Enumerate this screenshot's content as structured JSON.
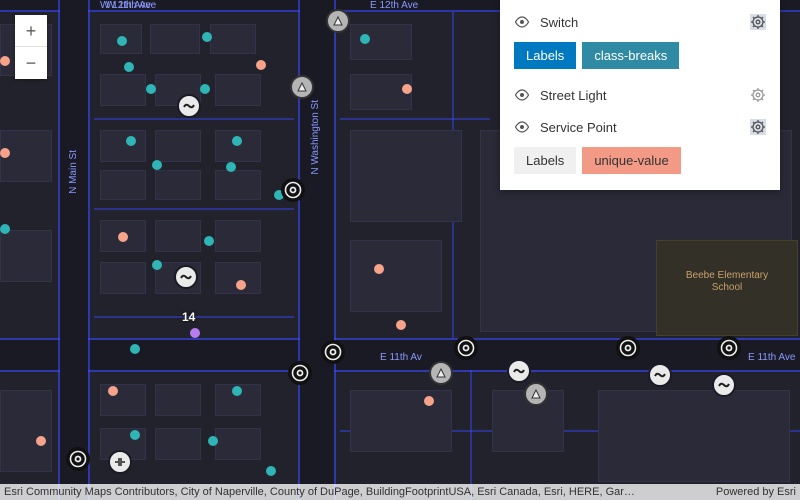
{
  "roads": {
    "w12th": "W 12th Ave",
    "e12th": "E 12th Ave",
    "w11th": "W 11th Ave",
    "e11th_a": "E 11th Av",
    "e11th_b": "E 11th Ave",
    "nmain": "N Main St",
    "nwash": "N Washington St"
  },
  "poi": {
    "beebe": "Beebe Elementary School"
  },
  "callouts": {
    "c14": "14"
  },
  "zoom": {
    "in": "+",
    "out": "−"
  },
  "layers": [
    {
      "name": "Switch",
      "gearActive": true
    },
    {
      "name": "Street Light",
      "gearActive": false
    },
    {
      "name": "Service Point",
      "gearActive": true
    }
  ],
  "chipsA": {
    "labels": "Labels",
    "renderer": "class-breaks"
  },
  "chipsB": {
    "labels": "Labels",
    "renderer": "unique-value"
  },
  "attribution": {
    "left": "Esri Community Maps Contributors, City of Naperville, County of DuPage, BuildingFootprintUSA, Esri Canada, Esri, HERE, Gar…",
    "right": "Powered by Esri"
  }
}
